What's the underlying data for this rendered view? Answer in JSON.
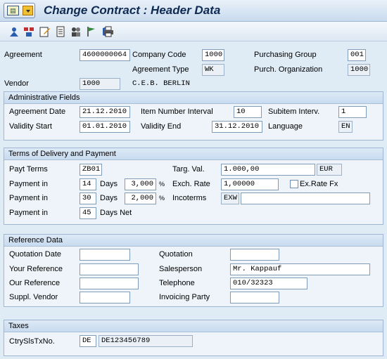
{
  "window": {
    "title": "Change Contract : Header Data",
    "menu_icon_glyph": "▤"
  },
  "toolbar": {
    "icons": [
      "person-icon",
      "org-icon",
      "edit-note-icon",
      "document-icon",
      "partners-icon",
      "flag-icon",
      "texts-icon",
      "print-icon"
    ]
  },
  "header": {
    "agreement_label": "Agreement",
    "agreement_value": "4600000064",
    "company_code_label": "Company Code",
    "company_code_value": "1000",
    "purch_group_label": "Purchasing Group",
    "purch_group_value": "001",
    "agreement_type_label": "Agreement Type",
    "agreement_type_value": "WK",
    "purch_org_label": "Purch. Organization",
    "purch_org_value": "1000",
    "vendor_label": "Vendor",
    "vendor_value": "1000",
    "vendor_name": "C.E.B. BERLIN"
  },
  "admin": {
    "title": "Administrative Fields",
    "agreement_date_label": "Agreement Date",
    "agreement_date_value": "21.12.2010",
    "item_interval_label": "Item Number Interval",
    "item_interval_value": "10",
    "subitem_interval_label": "Subitem Interv.",
    "subitem_interval_value": "1",
    "validity_start_label": "Validity Start",
    "validity_start_value": "01.01.2010",
    "validity_end_label": "Validity End",
    "validity_end_value": "31.12.2010",
    "language_label": "Language",
    "language_value": "EN"
  },
  "terms": {
    "title": "Terms of Delivery and Payment",
    "payt_terms_label": "Payt Terms",
    "payt_terms_value": "ZB01",
    "targ_val_label": "Targ. Val.",
    "targ_val_value": "1.000,00",
    "currency_value": "EUR",
    "payment_in_label": "Payment in",
    "days_label": "Days",
    "days_net_label": "Days Net",
    "pct_sign": "%",
    "payment1_days": "14",
    "payment1_pct": "3,000",
    "payment2_days": "30",
    "payment2_pct": "2,000",
    "payment3_days": "45",
    "exch_rate_label": "Exch. Rate",
    "exch_rate_value": "1,00000",
    "ex_rate_fx_label": "Ex.Rate Fx",
    "incoterms_label": "Incoterms",
    "incoterms_value": "EXW",
    "incoterms_text": ""
  },
  "reference": {
    "title": "Reference Data",
    "quotation_date_label": "Quotation Date",
    "quotation_date_value": "",
    "quotation_label": "Quotation",
    "quotation_value": "",
    "your_ref_label": "Your Reference",
    "your_ref_value": "",
    "salesperson_label": "Salesperson",
    "salesperson_value": "Mr. Kappauf",
    "our_ref_label": "Our Reference",
    "our_ref_value": "",
    "telephone_label": "Telephone",
    "telephone_value": "010/32323",
    "suppl_vendor_label": "Suppl. Vendor",
    "suppl_vendor_value": "",
    "invoicing_party_label": "Invoicing Party",
    "invoicing_party_value": ""
  },
  "taxes": {
    "title": "Taxes",
    "ctry_label": "CtrySlsTxNo.",
    "ctry_value": "DE",
    "vat_value": "DE123456789"
  }
}
